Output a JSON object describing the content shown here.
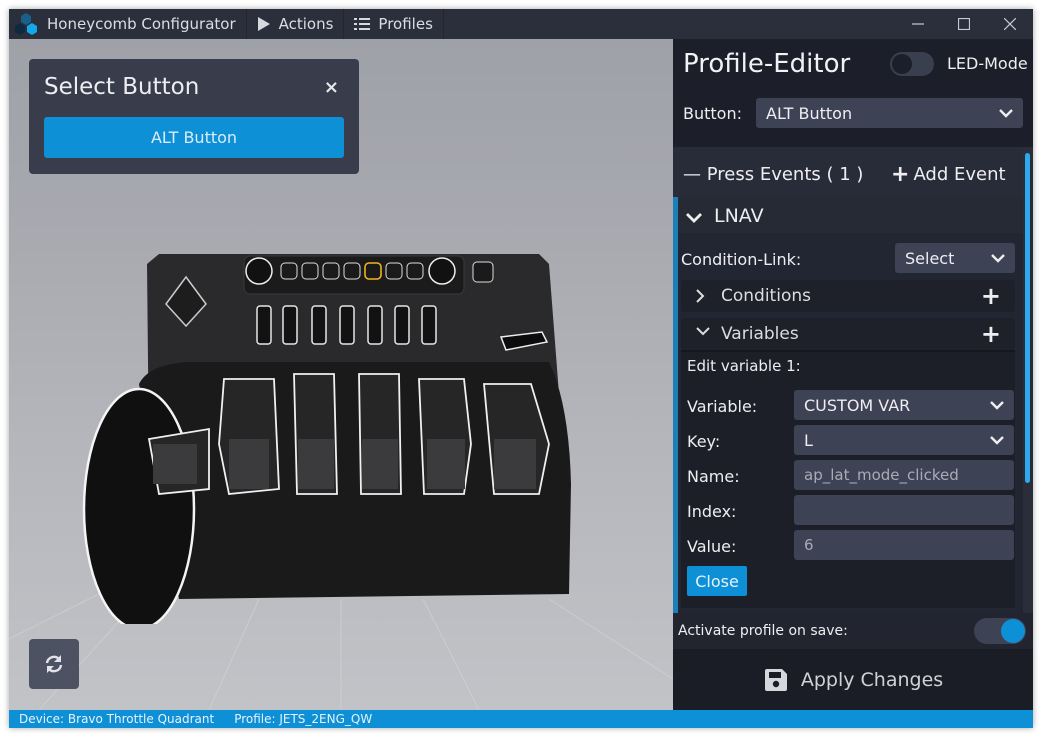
{
  "window": {
    "app_title": "Honeycomb Configurator",
    "menu": [
      {
        "label": "Actions",
        "icon": "play-icon"
      },
      {
        "label": "Profiles",
        "icon": "list-icon"
      }
    ],
    "controls": {
      "minimize": "—",
      "maximize": "☐",
      "close": "✕"
    }
  },
  "viewport": {
    "select_panel": {
      "title": "Select Button",
      "close_glyph": "×",
      "selected_button": "ALT Button"
    },
    "reset_view_icon": "refresh-icon",
    "device_model": "Bravo Throttle Quadrant 3D model"
  },
  "editor": {
    "title": "Profile-Editor",
    "led_mode": {
      "label": "LED-Mode",
      "on": false
    },
    "button_label": "Button:",
    "button_value": "ALT Button",
    "press_events": {
      "title": "— Press Events ( 1 )",
      "add_label": "Add Event"
    },
    "event": {
      "name": "LNAV",
      "condition_link_label": "Condition-Link:",
      "condition_link_value": "Select",
      "conditions_label": "Conditions",
      "variables_label": "Variables",
      "variable_editor": {
        "title": "Edit variable 1:",
        "fields": [
          {
            "label": "Variable:",
            "value": "CUSTOM VAR",
            "type": "select"
          },
          {
            "label": "Key:",
            "value": "L",
            "type": "select"
          },
          {
            "label": "Name:",
            "value": "ap_lat_mode_clicked",
            "type": "input"
          },
          {
            "label": "Index:",
            "value": "",
            "type": "input"
          },
          {
            "label": "Value:",
            "value": "6",
            "type": "input"
          }
        ],
        "close_label": "Close"
      }
    },
    "activate_on_save": {
      "label": "Activate profile on save:",
      "on": true
    },
    "apply_label": "Apply Changes"
  },
  "statusbar": {
    "device": "Device: Bravo Throttle Quadrant",
    "profile": "Profile: JETS_2ENG_QW"
  },
  "colors": {
    "accent": "#0e90d6",
    "panel_bg": "#1c1f29",
    "titlebar_bg": "#2b2f3c"
  }
}
